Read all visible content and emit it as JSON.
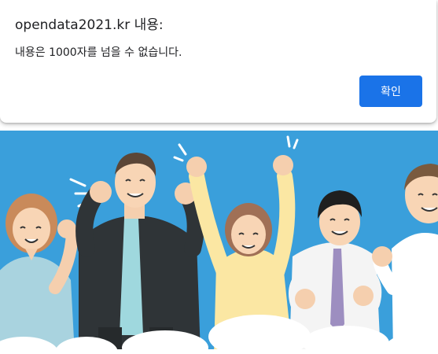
{
  "dialog": {
    "title": "opendata2021.kr 내용:",
    "message": "내용은 1000자를 넘을 수 없습니다.",
    "ok_label": "확인",
    "accent_color": "#1a73e8"
  },
  "banner": {
    "background_color": "#3a9fdb",
    "illustration": "cheering-people-illustration"
  }
}
